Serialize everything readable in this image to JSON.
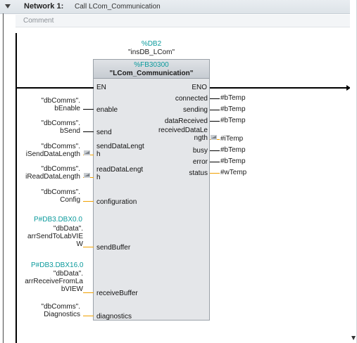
{
  "network": {
    "title": "Network 1:",
    "description": "Call LCom_Communication",
    "comment_placeholder": "Comment"
  },
  "block": {
    "instance_address": "%DB2",
    "instance_name": "\"insDB_LCom\"",
    "fb_address": "%FB30300",
    "fb_name": "\"LCom_Communication\"",
    "en": "EN",
    "eno": "ENO",
    "inputs": [
      {
        "pin": "enable",
        "operand_lines": [
          "\"dbComms\".",
          "bEnable"
        ]
      },
      {
        "pin": "send",
        "operand_lines": [
          "\"dbComms\".",
          "bSend"
        ]
      },
      {
        "pin_lines": [
          "sendDataLengt",
          "h"
        ],
        "operand_lines": [
          "\"dbComms\".",
          "iSendDataLength"
        ]
      },
      {
        "pin_lines": [
          "readDataLengt",
          "h"
        ],
        "operand_lines": [
          "\"dbComms\".",
          "iReadDataLength"
        ]
      },
      {
        "pin": "configuration",
        "operand_lines": [
          "\"dbComms\".",
          "Config"
        ]
      },
      {
        "pin": "sendBuffer",
        "address": "P#DB3.DBX0.0",
        "operand_lines": [
          "\"dbData\".",
          "arrSendToLabVIE",
          "W"
        ]
      },
      {
        "pin": "receiveBuffer",
        "address": "P#DB3.DBX16.0",
        "operand_lines": [
          "\"dbData\".",
          "arrReceiveFromLa",
          "bVIEW"
        ]
      },
      {
        "pin": "diagnostics",
        "operand_lines": [
          "\"dbComms\".",
          "Diagnostics"
        ]
      }
    ],
    "outputs": [
      {
        "pin": "connected",
        "operand": "#bTemp"
      },
      {
        "pin": "sending",
        "operand": "#bTemp"
      },
      {
        "pin": "dataReceived",
        "operand": "#bTemp"
      },
      {
        "pin_lines": [
          "receivedDataLe",
          "ngth"
        ],
        "operand": "#iTemp"
      },
      {
        "pin": "busy",
        "operand": "#bTemp"
      },
      {
        "pin": "error",
        "operand": "#bTemp"
      },
      {
        "pin": "status",
        "operand": "#wTemp"
      }
    ]
  },
  "colors": {
    "accent_teal": "#0a9a9c",
    "wire_orange": "#f0a000",
    "header_bg": "#dde3e8"
  }
}
